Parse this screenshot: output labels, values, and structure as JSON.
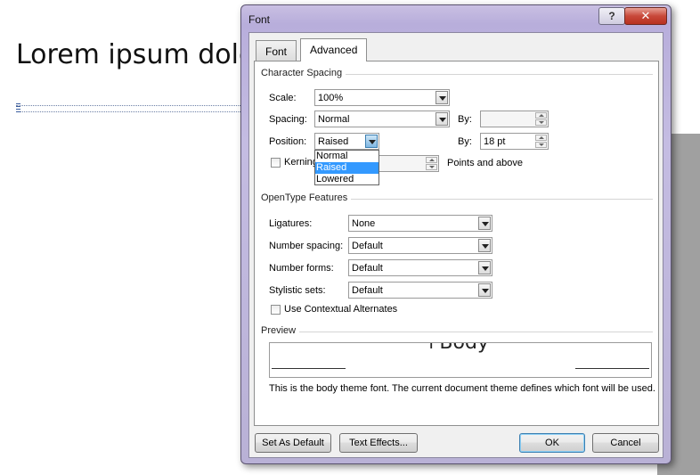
{
  "document": {
    "heading": "Lorem ipsum dolo"
  },
  "dialog": {
    "title": "Font",
    "help_label": "?",
    "close_label": "✕",
    "tabs": [
      {
        "label": "Font",
        "active": false
      },
      {
        "label": "Advanced",
        "active": true
      }
    ],
    "character_spacing": {
      "title": "Character Spacing",
      "scale_label": "Scale:",
      "scale_value": "100%",
      "spacing_label": "Spacing:",
      "spacing_value": "Normal",
      "spacing_by_label": "By:",
      "spacing_by_value": "",
      "position_label": "Position:",
      "position_value": "Raised",
      "position_by_label": "By:",
      "position_by_value": "18 pt",
      "position_options": [
        "Normal",
        "Raised",
        "Lowered"
      ],
      "position_selected_option": "Raised",
      "kerning_label": "Kerning",
      "kerning_checked": false,
      "kerning_value": "",
      "kerning_suffix": "Points and above"
    },
    "opentype": {
      "title": "OpenType Features",
      "ligatures_label": "Ligatures:",
      "ligatures_value": "None",
      "number_spacing_label": "Number spacing:",
      "number_spacing_value": "Default",
      "number_forms_label": "Number forms:",
      "number_forms_value": "Default",
      "stylistic_sets_label": "Stylistic sets:",
      "stylistic_sets_value": "Default",
      "contextual_alternates_label": "Use Contextual Alternates",
      "contextual_alternates_checked": false
    },
    "preview": {
      "title": "Preview",
      "sample_text": "+Body",
      "description": "This is the body theme font. The current document theme defines which font will be used."
    },
    "buttons": {
      "set_as_default": "Set As Default",
      "text_effects": "Text Effects...",
      "ok": "OK",
      "cancel": "Cancel"
    }
  }
}
